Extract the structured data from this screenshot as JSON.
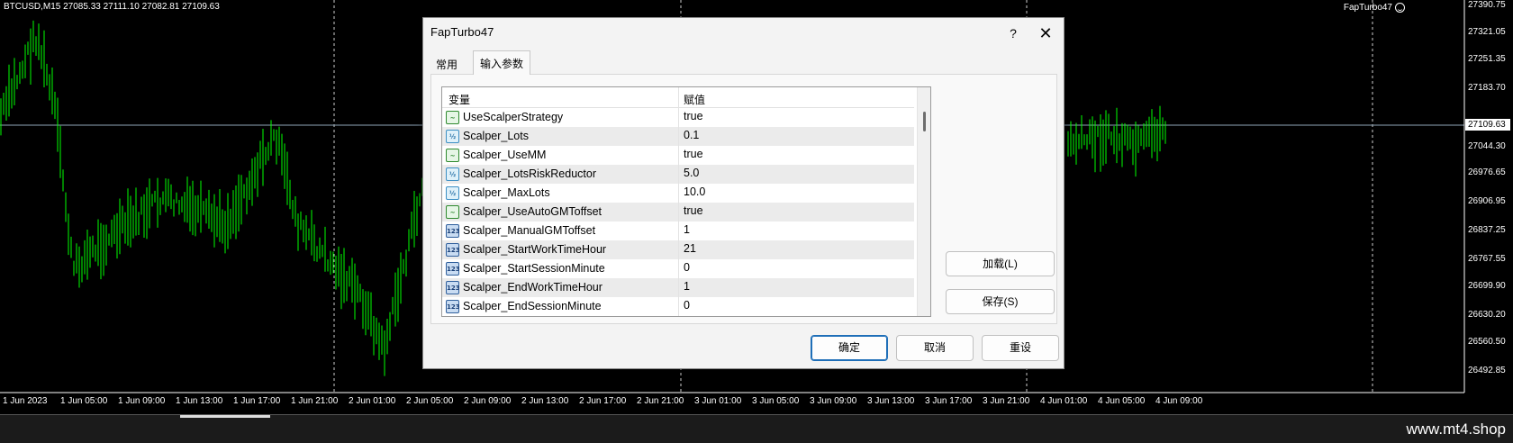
{
  "chart": {
    "header": "BTCUSD,M15  27085.33 27111.10 27082.81 27109.63",
    "ea_label": "FapTurbo47",
    "price_scale": [
      "27390.75",
      "27321.05",
      "27251.35",
      "27183.70",
      "27044.30",
      "26976.65",
      "26906.95",
      "26837.25",
      "26767.55",
      "26699.90",
      "26630.20",
      "26560.50",
      "26492.85"
    ],
    "current_price": "27109.63",
    "time_scale": [
      "1 Jun 2023",
      "1 Jun 05:00",
      "1 Jun 09:00",
      "1 Jun 13:00",
      "1 Jun 17:00",
      "1 Jun 21:00",
      "2 Jun 01:00",
      "2 Jun 05:00",
      "2 Jun 09:00",
      "2 Jun 13:00",
      "2 Jun 17:00",
      "2 Jun 21:00",
      "3 Jun 01:00",
      "3 Jun 05:00",
      "3 Jun 09:00",
      "3 Jun 13:00",
      "3 Jun 17:00",
      "3 Jun 21:00",
      "4 Jun 01:00",
      "4 Jun 05:00",
      "4 Jun 09:00"
    ],
    "colors": {
      "background": "#000000",
      "candles": "#00ff00",
      "grid": "#cfcfcf"
    }
  },
  "watermark": "www.mt4.shop",
  "dialog": {
    "title": "FapTurbo47",
    "help": "?",
    "close": "✕",
    "tabs": [
      {
        "label": "常用"
      },
      {
        "label": "输入参数"
      }
    ],
    "grid": {
      "col_variable": "变量",
      "col_value": "赋值",
      "rows": [
        {
          "icon": "bool-icon",
          "glyph": "~",
          "name": "UseScalperStrategy",
          "value": "true"
        },
        {
          "icon": "double-icon",
          "glyph": "½",
          "name": "Scalper_Lots",
          "value": "0.1"
        },
        {
          "icon": "bool-icon",
          "glyph": "~",
          "name": "Scalper_UseMM",
          "value": "true"
        },
        {
          "icon": "double-icon",
          "glyph": "½",
          "name": "Scalper_LotsRiskReductor",
          "value": "5.0"
        },
        {
          "icon": "double-icon",
          "glyph": "½",
          "name": "Scalper_MaxLots",
          "value": "10.0"
        },
        {
          "icon": "bool-icon",
          "glyph": "~",
          "name": "Scalper_UseAutoGMToffset",
          "value": "true"
        },
        {
          "icon": "int-icon",
          "glyph": "123",
          "name": "Scalper_ManualGMToffset",
          "value": "1"
        },
        {
          "icon": "int-icon",
          "glyph": "123",
          "name": "Scalper_StartWorkTimeHour",
          "value": "21"
        },
        {
          "icon": "int-icon",
          "glyph": "123",
          "name": "Scalper_StartSessionMinute",
          "value": "0"
        },
        {
          "icon": "int-icon",
          "glyph": "123",
          "name": "Scalper_EndWorkTimeHour",
          "value": "1"
        },
        {
          "icon": "int-icon",
          "glyph": "123",
          "name": "Scalper_EndSessionMinute",
          "value": "0"
        }
      ]
    },
    "load_button": "加载(L)",
    "save_button": "保存(S)",
    "ok_button": "确定",
    "cancel_button": "取消",
    "reset_button": "重设"
  }
}
